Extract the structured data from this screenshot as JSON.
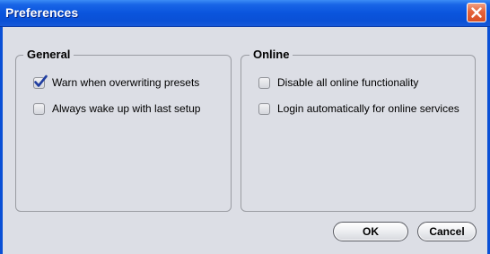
{
  "window": {
    "title": "Preferences",
    "close_icon": "close-icon"
  },
  "groups": {
    "general": {
      "label": "General",
      "options": [
        {
          "label": "Warn when overwriting presets",
          "checked": true
        },
        {
          "label": "Always wake up with last setup",
          "checked": false
        }
      ]
    },
    "online": {
      "label": "Online",
      "options": [
        {
          "label": "Disable all online functionality",
          "checked": false
        },
        {
          "label": "Login automatically for online services",
          "checked": false
        }
      ]
    }
  },
  "buttons": {
    "ok_label": "OK",
    "cancel_label": "Cancel"
  },
  "colors": {
    "titlebar": "#0a55dd",
    "close_button": "#e4633a",
    "dialog_background": "#dcdee5",
    "checkmark": "#1f3da0"
  }
}
